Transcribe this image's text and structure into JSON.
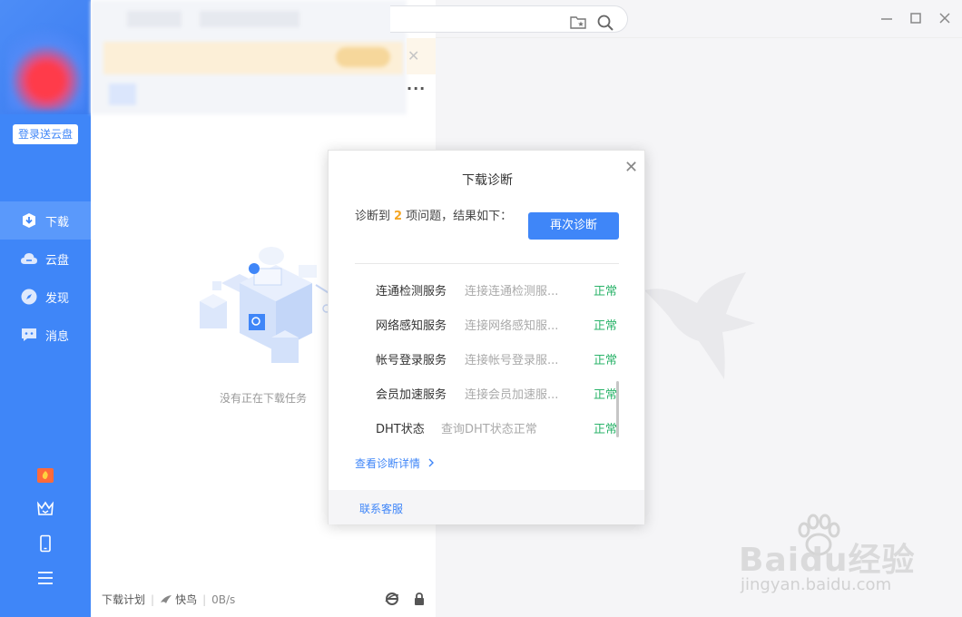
{
  "sidebar": {
    "login_label": "登录送云盘",
    "items": [
      {
        "label": "下载",
        "icon": "download-icon"
      },
      {
        "label": "云盘",
        "icon": "cloud-icon"
      },
      {
        "label": "发现",
        "icon": "compass-icon"
      },
      {
        "label": "消息",
        "icon": "message-icon"
      }
    ],
    "bottom_icons": [
      "gift-icon",
      "crown-icon",
      "phone-icon",
      "menu-icon"
    ]
  },
  "downloads": {
    "empty_text": "没有正在下载任务",
    "footer": {
      "plan_label": "下载计划",
      "bird_label": "快鸟",
      "speed": "0B/s"
    }
  },
  "dialog": {
    "title": "下载诊断",
    "summary_prefix": "诊断到",
    "issue_count": "2",
    "summary_suffix": "项问题，结果如下：",
    "rediagnose_label": "再次诊断",
    "rows": [
      {
        "name": "连通检测服务",
        "detail": "连接连通检测服...",
        "status": "正常"
      },
      {
        "name": "网络感知服务",
        "detail": "连接网络感知服...",
        "status": "正常"
      },
      {
        "name": "帐号登录服务",
        "detail": "连接帐号登录服...",
        "status": "正常"
      },
      {
        "name": "会员加速服务",
        "detail": "连接会员加速服...",
        "status": "正常"
      },
      {
        "name": "DHT状态",
        "detail": "查询DHT状态正常",
        "status": "正常"
      }
    ],
    "details_link": "查看诊断详情",
    "contact_label": "联系客服"
  },
  "watermark": {
    "brand": "Baidu经验",
    "url": "jingyan.baidu.com"
  },
  "colors": {
    "accent": "#3f86f8",
    "ok": "#2bb36a",
    "count": "#f5a623"
  }
}
